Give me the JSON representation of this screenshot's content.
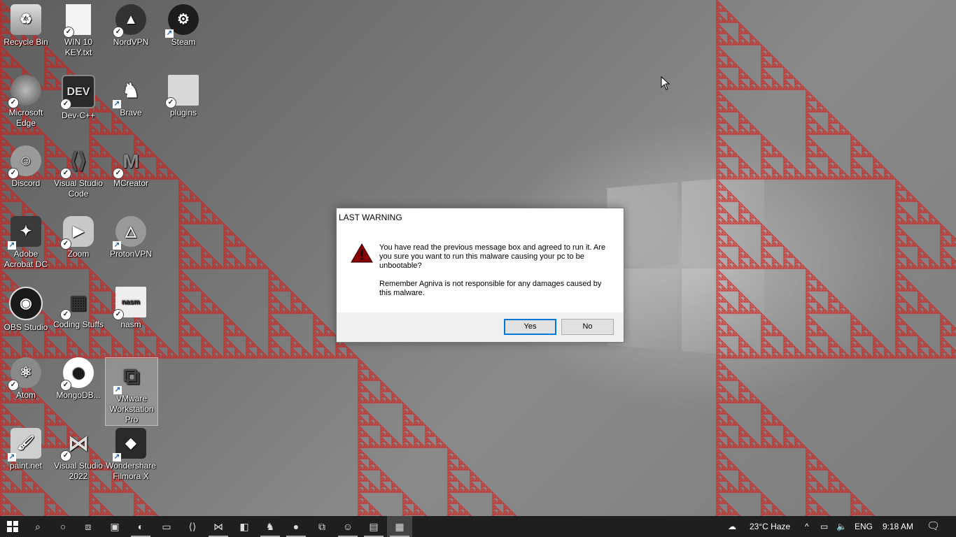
{
  "desktop": {
    "icons": [
      {
        "label": "Recycle Bin"
      },
      {
        "label": "WIN 10 KEY.txt"
      },
      {
        "label": "NordVPN"
      },
      {
        "label": "Steam"
      },
      {
        "label": "Microsoft Edge"
      },
      {
        "label": "Dev-C++"
      },
      {
        "label": "Brave"
      },
      {
        "label": "plugins"
      },
      {
        "label": "Discord"
      },
      {
        "label": "Visual Studio Code"
      },
      {
        "label": "MCreator"
      },
      {
        "label": "Adobe Acrobat DC"
      },
      {
        "label": "Zoom"
      },
      {
        "label": "ProtonVPN"
      },
      {
        "label": "OBS Studio"
      },
      {
        "label": "Coding Stuffs"
      },
      {
        "label": "nasm"
      },
      {
        "label": "Atom"
      },
      {
        "label": "MongoDB..."
      },
      {
        "label": "VMware Workstation Pro"
      },
      {
        "label": "paint.net"
      },
      {
        "label": "Visual Studio 2022"
      },
      {
        "label": "Wondershare Filmora X"
      }
    ],
    "overlay_color": "#d81b1b"
  },
  "dialog": {
    "title": "LAST WARNING",
    "message_1": "You have read the previous message box and agreed to run it. Are you sure you want to run this malware causing your pc to be unbootable?",
    "message_2": "Remember Agniva is not responsible for any damages caused by this malware.",
    "yes_label": "Yes",
    "no_label": "No"
  },
  "taskbar": {
    "weather": "23°C  Haze",
    "language": "ENG",
    "time": "9:18 AM"
  }
}
